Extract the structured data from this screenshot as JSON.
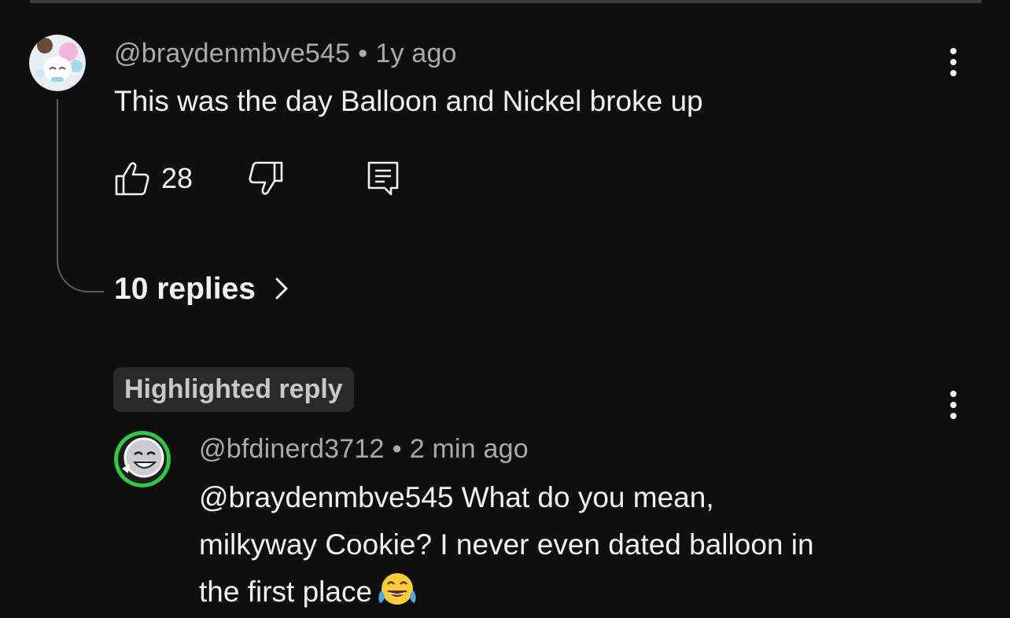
{
  "comment": {
    "username": "@braydenmbve545",
    "separator": "•",
    "time": "1y ago",
    "text": "This was the day Balloon and Nickel broke up",
    "like_count": "28",
    "replies_label": "10 replies"
  },
  "highlighted_badge": "Highlighted reply",
  "reply": {
    "username": "@bfdinerd3712",
    "separator": "•",
    "time": "2 min ago",
    "mention": "@braydenmbve545",
    "line1_rest": " What do you mean,",
    "line2": "milkyway Cookie? I never even dated balloon in",
    "line3": "the first place",
    "emoji": "face-with-tears-of-joy"
  },
  "icons": {
    "like": "thumbs-up-icon",
    "dislike": "thumbs-down-icon",
    "reply": "reply-icon",
    "more": "more-vert-icon",
    "chevron": "chevron-right-icon"
  },
  "colors": {
    "background": "#0f0f0f",
    "text": "#f1f1f1",
    "secondary_text": "#aaaaaa",
    "badge_bg": "#2a2a2a",
    "reply_avatar_ring": "#2ecc40"
  }
}
